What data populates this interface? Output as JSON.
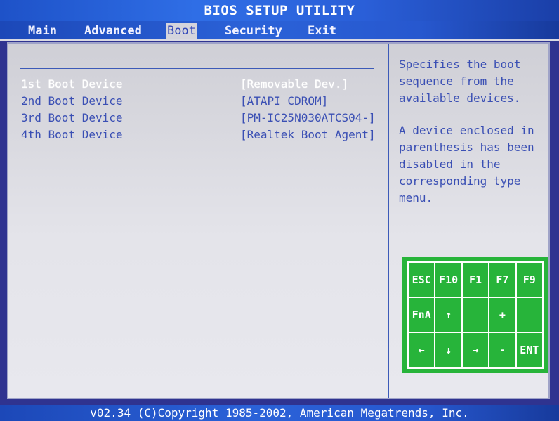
{
  "title": "BIOS SETUP UTILITY",
  "menu": {
    "tabs": [
      "Main",
      "Advanced",
      "Boot",
      "Security",
      "Exit"
    ],
    "active": "Boot"
  },
  "boot_devices": [
    {
      "label": "1st Boot Device",
      "value": "[Removable Dev.]",
      "selected": true
    },
    {
      "label": "2nd Boot Device",
      "value": "[ATAPI CDROM]",
      "selected": false
    },
    {
      "label": "3rd Boot Device",
      "value": "[PM-IC25N030ATCS04-]",
      "selected": false
    },
    {
      "label": "4th Boot Device",
      "value": "[Realtek Boot Agent]",
      "selected": false
    }
  ],
  "help": {
    "line1": "Specifies the boot\nsequence from the\navailable devices.",
    "line2": "A device enclosed in\nparenthesis has been\ndisabled in the\ncorresponding type\nmenu."
  },
  "keys": [
    "ESC",
    "F10",
    "F1",
    "F7",
    "F9",
    "FnA",
    "↑",
    "",
    "+",
    "",
    "←",
    "↓",
    "→",
    "-",
    "ENT"
  ],
  "footer": "v02.34 (C)Copyright 1985-2002, American Megatrends, Inc.",
  "colors": {
    "accent_blue": "#2f45b8",
    "panel": "#e4e4ea",
    "legend_green": "#27b43a"
  }
}
